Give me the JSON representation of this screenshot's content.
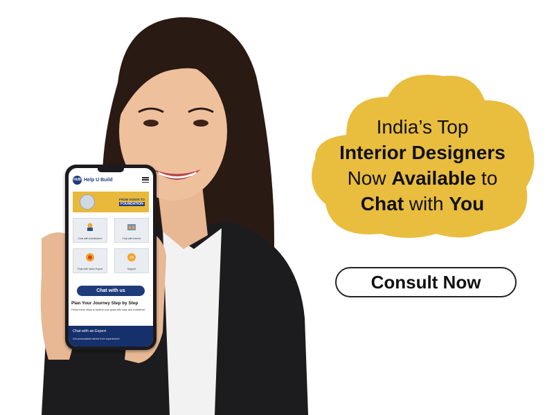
{
  "headline": {
    "line1": "India’s Top",
    "line2": "Interior Designers",
    "line3_normal": "Now ",
    "line3_bold": "Available",
    "line3_end": " to",
    "line4_bold1": "Chat",
    "line4_normal": " with ",
    "line4_bold2": "You"
  },
  "cta": {
    "label": "Consult Now"
  },
  "colors": {
    "cloud": "#e9bd3e",
    "brand": "#1f3b7a",
    "phone_body": "#1b1b1f"
  },
  "phone": {
    "brand": "Help U Build",
    "logo_text": "HUB",
    "banner": {
      "line1": "FROM VISION TO",
      "line2": "FOUNDATION"
    },
    "tiles": [
      {
        "label": "Chat with Architecture",
        "icon": "architect-icon"
      },
      {
        "label": "Chat with Interior",
        "icon": "interior-icon"
      },
      {
        "label": "Chat with Vastu Expert",
        "icon": "vastu-icon"
      },
      {
        "label": "Support",
        "icon": "support-icon"
      }
    ],
    "chat_button": "Chat with us",
    "plan_title": "Plan Your Journey Step by Step",
    "plan_text": "Follow these steps to achieve your goals with ease and confidence:",
    "expert_title": "Chat with an Expert",
    "expert_sub": "Get personalized advice from experienced"
  }
}
